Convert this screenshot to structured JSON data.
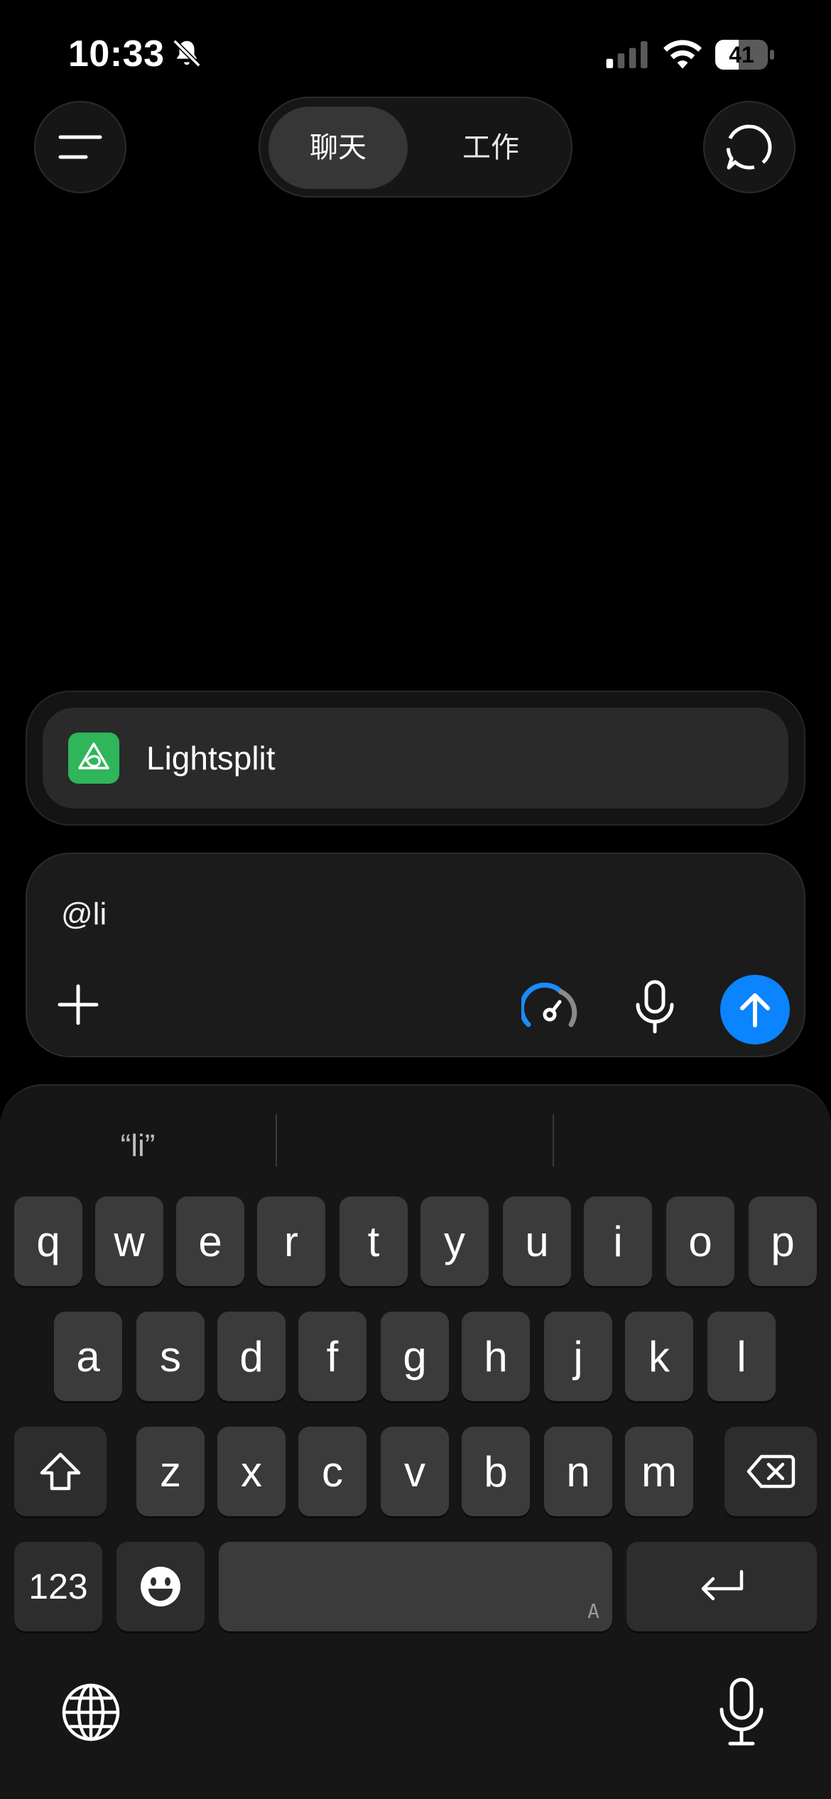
{
  "status_bar": {
    "time": "10:33",
    "battery": "41",
    "icons": [
      "bell-slash-icon",
      "cellular-signal-icon",
      "wifi-icon",
      "battery-icon"
    ]
  },
  "top_bar": {
    "tabs": [
      {
        "label": "聊天",
        "selected": true
      },
      {
        "label": "工作",
        "selected": false
      }
    ],
    "icons": [
      "menu-icon",
      "new-chat-icon"
    ]
  },
  "suggestion": {
    "app_name": "Lightsplit",
    "icon_color": "#2fb55a"
  },
  "composer": {
    "text": "@li",
    "icons": [
      "plus-icon",
      "speedometer-icon",
      "microphone-icon",
      "send-arrow-up-icon"
    ],
    "send_color": "#0a84ff"
  },
  "keyboard": {
    "predictions": [
      "“li”",
      "",
      ""
    ],
    "row1": [
      "q",
      "w",
      "e",
      "r",
      "t",
      "y",
      "u",
      "i",
      "o",
      "p"
    ],
    "row2": [
      "a",
      "s",
      "d",
      "f",
      "g",
      "h",
      "j",
      "k",
      "l"
    ],
    "row3": [
      "z",
      "x",
      "c",
      "v",
      "b",
      "n",
      "m"
    ],
    "numbers_label": "123",
    "space_hint": "A",
    "icons": [
      "shift-icon",
      "delete-icon",
      "emoji-icon",
      "return-icon",
      "globe-icon",
      "dictation-mic-icon"
    ]
  }
}
